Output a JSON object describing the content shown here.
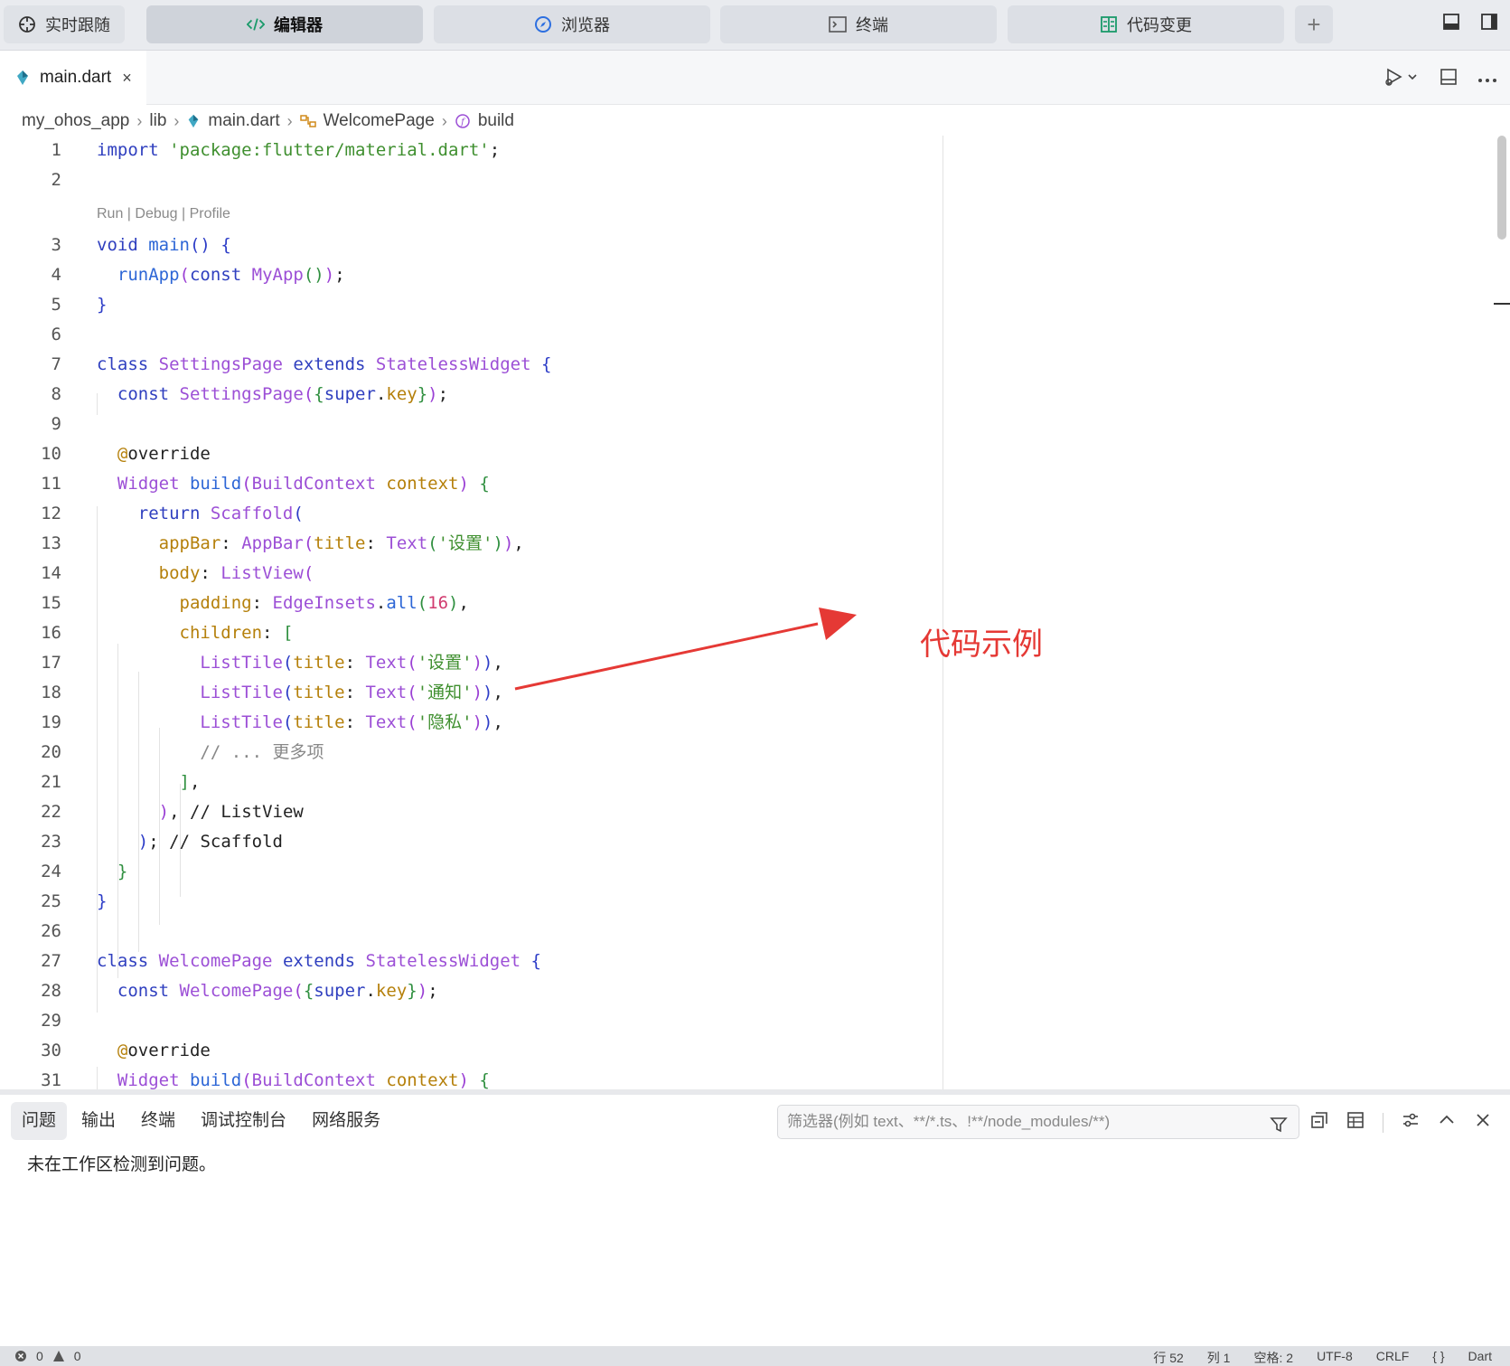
{
  "topbar": {
    "live_follow": "实时跟随",
    "tabs": [
      {
        "label": "编辑器",
        "icon": "code-icon"
      },
      {
        "label": "浏览器",
        "icon": "compass-icon"
      },
      {
        "label": "终端",
        "icon": "terminal-icon"
      },
      {
        "label": "代码变更",
        "icon": "diff-icon"
      }
    ],
    "add": "+"
  },
  "filetab": {
    "name": "main.dart",
    "close": "×"
  },
  "breadcrumb": [
    "my_ohos_app",
    "lib",
    "main.dart",
    "WelcomePage",
    "build"
  ],
  "editor": {
    "codelens": "Run | Debug | Profile",
    "line_numbers": [
      "1",
      "2",
      "3",
      "4",
      "5",
      "6",
      "7",
      "8",
      "9",
      "10",
      "11",
      "12",
      "13",
      "14",
      "15",
      "16",
      "17",
      "18",
      "19",
      "20",
      "21",
      "22",
      "23",
      "24",
      "25",
      "26",
      "27",
      "28",
      "29",
      "30",
      "31"
    ]
  },
  "annotation": {
    "label": "代码示例",
    "color": "#e53935"
  },
  "panel": {
    "tabs": [
      "问题",
      "输出",
      "终端",
      "调试控制台",
      "网络服务"
    ],
    "filter_placeholder": "筛选器(例如 text、**/*.ts、!**/node_modules/**)",
    "message": "未在工作区检测到问题。"
  },
  "statusbar": {
    "errors": "0",
    "warnings": "0",
    "line": "行 52",
    "col": "列 1",
    "spaces": "空格: 2",
    "encoding": "UTF-8",
    "eol": "CRLF",
    "braces": "{ }",
    "language": "Dart"
  },
  "colors": {
    "keyword": "#2f3fbf",
    "string": "#3f8f2f",
    "type": "#9c4fd6",
    "accent_red": "#e53935"
  }
}
